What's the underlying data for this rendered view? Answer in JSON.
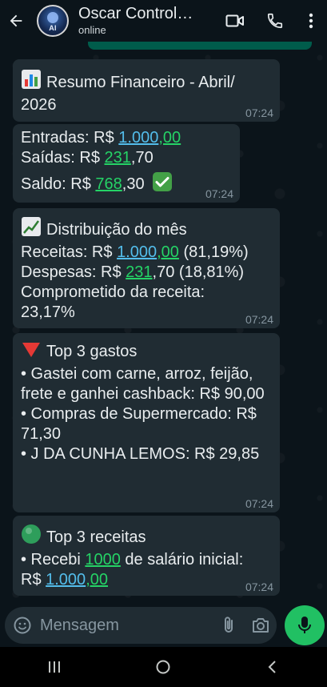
{
  "header": {
    "contact_name": "Oscar Control…",
    "status": "online",
    "avatar_text": "AI"
  },
  "messages": [
    {
      "title": "Resumo Financeiro - Abril/ 2026",
      "icon": "bar-chart-emoji",
      "time": "07:24"
    },
    {
      "lines": [
        {
          "prefix": "Entradas: R$ ",
          "link": "1.000",
          "link2": ",00",
          "suffix": ""
        },
        {
          "prefix": "Saídas: R$ ",
          "link": "231",
          "suffix": ",70"
        },
        {
          "prefix": "Saldo: R$ ",
          "link": "768",
          "suffix": ",30"
        }
      ],
      "check_icon": "check-mark-emoji",
      "time": "07:24"
    },
    {
      "title": "Distribuição do mês",
      "icon": "chart-increasing-emoji",
      "lines": [
        {
          "prefix": "Receitas: R$ ",
          "link": "1.000",
          "link2": ",00",
          "suffix": " (81,19%)"
        },
        {
          "prefix": "Despesas: R$ ",
          "link": "231",
          "suffix": ",70 (18,81%)"
        },
        {
          "text": "Comprometido da receita: 23,17%"
        }
      ],
      "time": "07:24"
    },
    {
      "title": "Top 3 gastos",
      "icon": "red-triangle-emoji",
      "items": [
        "• Gastei com carne, arroz, feijão, frete e ganhei cashback: R$ 90,00",
        "• Compras de Supermercado: R$ 71,30",
        "• J DA CUNHA LEMOS: R$ 29,85"
      ],
      "time": "07:24"
    },
    {
      "title": "Top 3 receitas",
      "icon": "green-circle-emoji",
      "line_prefix": "• Recebi ",
      "line_link": "1000",
      "line_suffix": " de salário inicial:",
      "line2_prefix": "R$ ",
      "line2_link": "1.000",
      "line2_link2": ",00",
      "time": "07:24"
    }
  ],
  "composer": {
    "placeholder": "Mensagem"
  },
  "colors": {
    "background": "#0b141a",
    "bubble": "#202c33",
    "link": "#53bdeb",
    "link_green": "#25d366",
    "mic": "#21c063"
  }
}
